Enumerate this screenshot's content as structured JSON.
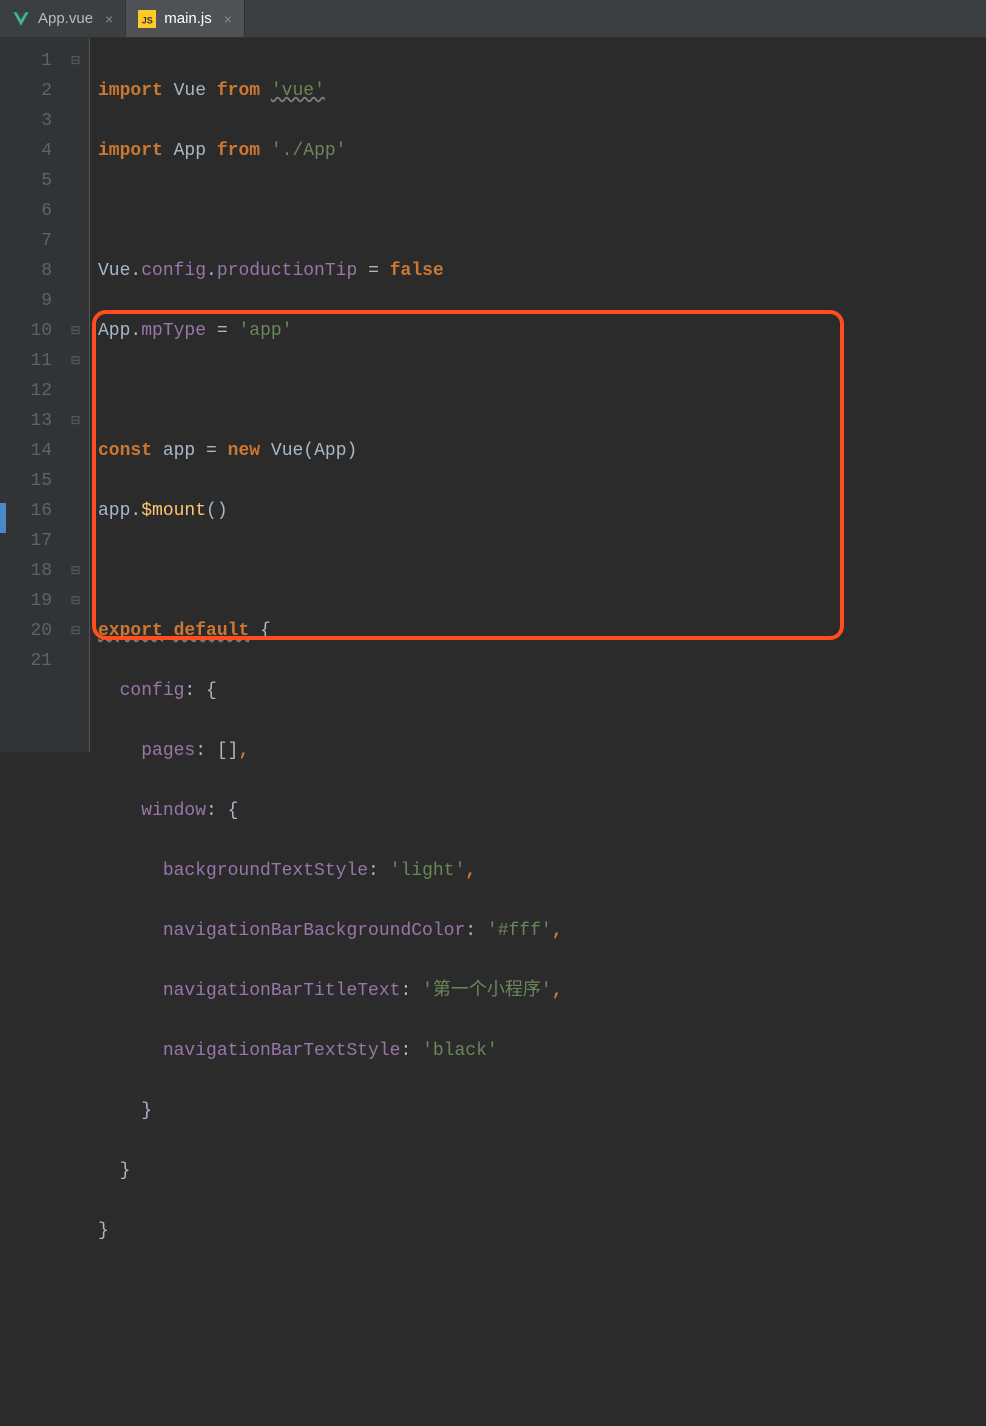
{
  "tabs": [
    {
      "label": "App.vue",
      "icon": "vue"
    },
    {
      "label": "main.js",
      "icon": "js"
    }
  ],
  "lineNumbers": [
    "1",
    "2",
    "3",
    "4",
    "5",
    "6",
    "7",
    "8",
    "9",
    "10",
    "11",
    "12",
    "13",
    "14",
    "15",
    "16",
    "17",
    "18",
    "19",
    "20",
    "21"
  ],
  "folds": {
    "l1": "⊟",
    "l10": "⊟",
    "l11": "⊟",
    "l13": "⊟",
    "l18": "⊟",
    "l19": "⊟",
    "l20": "⊟"
  },
  "code": {
    "kw_import": "import",
    "kw_from": "from",
    "kw_const": "const",
    "kw_new": "new",
    "kw_false": "false",
    "kw_export": "export",
    "kw_default": "default",
    "Vue": "Vue",
    "App": "App",
    "str_vue": "'vue'",
    "str_app_path": "'./App'",
    "config": "config",
    "productionTip": "productionTip",
    "mpType": "mpType",
    "str_app": "'app'",
    "app_var": "app",
    "mount": "$mount",
    "cfg_key": "config",
    "pages_key": "pages",
    "window_key": "window",
    "backgroundTextStyle": "backgroundTextStyle",
    "str_light": "'light'",
    "navigationBarBackgroundColor": "navigationBarBackgroundColor",
    "str_fff": "'#fff'",
    "navigationBarTitleText": "navigationBarTitleText",
    "str_title": "'第一个小程序'",
    "navigationBarTextStyle": "navigationBarTextStyle",
    "str_black": "'black'"
  }
}
